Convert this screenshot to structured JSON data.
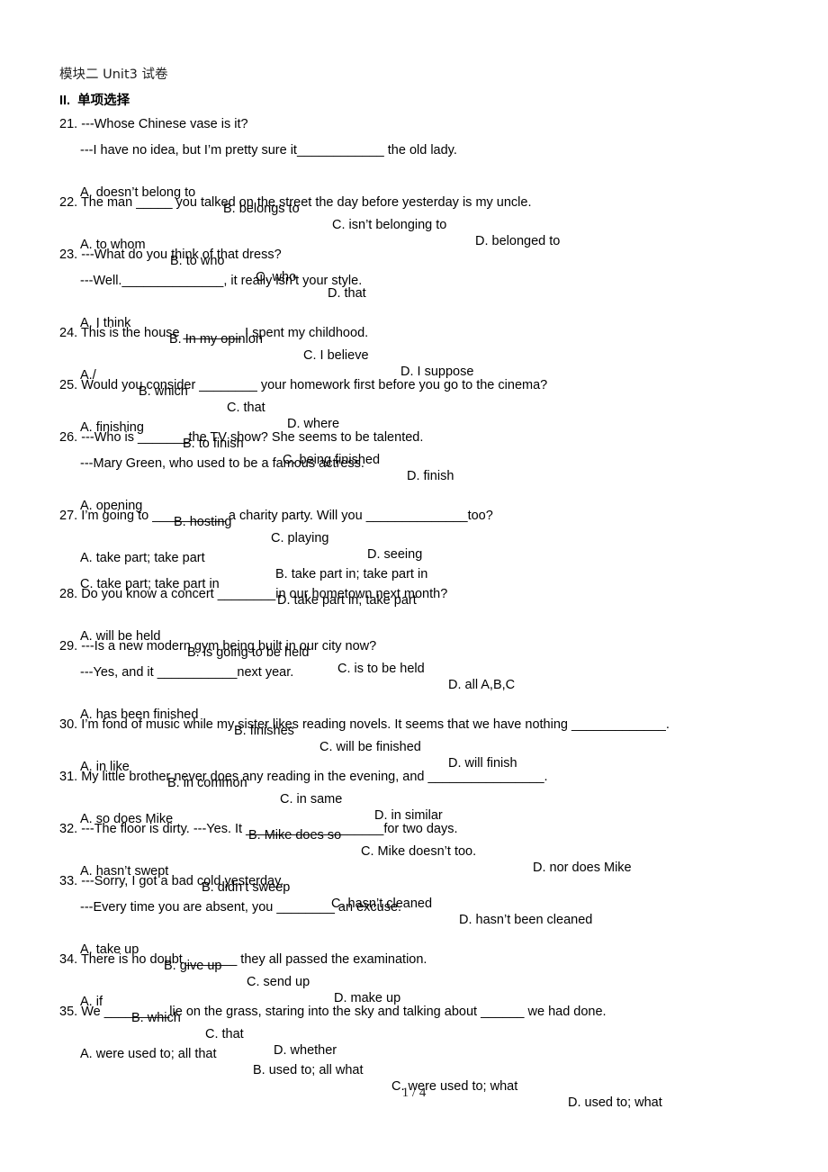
{
  "document": {
    "title": "模块二 Unit3 试卷",
    "section": "II.  单项选择",
    "questions": [
      {
        "number": "21.",
        "lines": [
          "---Whose Chinese vase is it?",
          "---I have no idea, but I’m pretty sure it____________ the old lady."
        ],
        "options": [
          "A. doesn’t belong to",
          "B. belongs to",
          "C. isn’t belonging to",
          "D. belonged to"
        ]
      },
      {
        "number": "22.",
        "lines": [
          "The man _____ you talked on the street the day before yesterday is my uncle."
        ],
        "options": [
          "A. to whom",
          "B. to who",
          "C. who",
          "D. that"
        ]
      },
      {
        "number": "23.",
        "lines": [
          "---What do you think of that dress?",
          "---Well.______________, it really isn’t your style."
        ],
        "options": [
          "A. I think",
          "B. In my opinion",
          "C. I believe",
          "D. I suppose"
        ]
      },
      {
        "number": "24.",
        "lines": [
          "This is the house ________ I spent my childhood."
        ],
        "options": [
          "A./",
          "B. which",
          "C. that",
          "D. where"
        ]
      },
      {
        "number": "25.",
        "lines": [
          "Would you consider ________ your homework first before you go to the cinema?"
        ],
        "options": [
          "A. finishing",
          "B. to finish",
          "C. being finished",
          "D. finish"
        ]
      },
      {
        "number": "26.",
        "lines": [
          "---Who is _______the TV show? She seems to be talented.",
          "---Mary Green, who used to be a famous actress."
        ],
        "options": [
          "A. opening",
          "B. hosting",
          "C. playing",
          "D. seeing"
        ]
      },
      {
        "number": "27.",
        "lines": [
          "I’m going to __________ a charity party. Will you ______________too?"
        ],
        "options": [
          "A. take part; take part",
          "B. take part in; take part in",
          "C. take part; take part in",
          "D. take part in; take part"
        ]
      },
      {
        "number": "28.",
        "lines": [
          "Do you know a concert ________in our hometown next month?"
        ],
        "options": [
          "A. will be held",
          "B. is going to be held",
          "C. is to be held",
          "D. all A,B,C"
        ]
      },
      {
        "number": "29.",
        "lines": [
          "---Is a new modern gym being built in our city now?",
          "---Yes, and it ___________next year."
        ],
        "options": [
          "A. has been finished",
          "B. finishes",
          "C. will be finished",
          "D. will finish"
        ]
      },
      {
        "number": "30.",
        "lines": [
          "I’m fond of music while my sister likes reading novels. It seems that we have nothing _____________."
        ],
        "options": [
          "A. in like",
          "B. in common",
          "C. in same",
          "D. in similar"
        ]
      },
      {
        "number": "31.",
        "lines": [
          "My little brother never does any reading in the evening, and ________________."
        ],
        "options": [
          "A. so does Mike",
          "B. Mike does so",
          "C. Mike doesn’t too.",
          "D. nor does Mike"
        ]
      },
      {
        "number": "32.",
        "lines": [
          "---The floor is dirty. ---Yes. It ___________________for two days."
        ],
        "options": [
          "A. hasn’t swept",
          "B. didn’t sweep",
          "C. hasn’t cleaned",
          "D. hasn’t been cleaned"
        ]
      },
      {
        "number": "33.",
        "lines": [
          "---Sorry, I got a bad cold yesterday.",
          "---Every time you are absent, you ________ an excuse."
        ],
        "options": [
          "A. take up",
          "B. give up",
          "C. send up",
          "D. make up"
        ]
      },
      {
        "number": "34.",
        "lines": [
          "There is no doubt _______ they all passed the examination."
        ],
        "options": [
          "A. if",
          "B. which",
          "C. that",
          "D. whether"
        ]
      },
      {
        "number": "35.",
        "lines": [
          "We _________lie on the grass, staring into the sky and talking about ______ we had done."
        ],
        "options": [
          "A. were used to; all that",
          "B. used to; all what",
          "C. were used to; what",
          "D. used to; what"
        ]
      }
    ],
    "page_indicator": "1  / 4"
  }
}
